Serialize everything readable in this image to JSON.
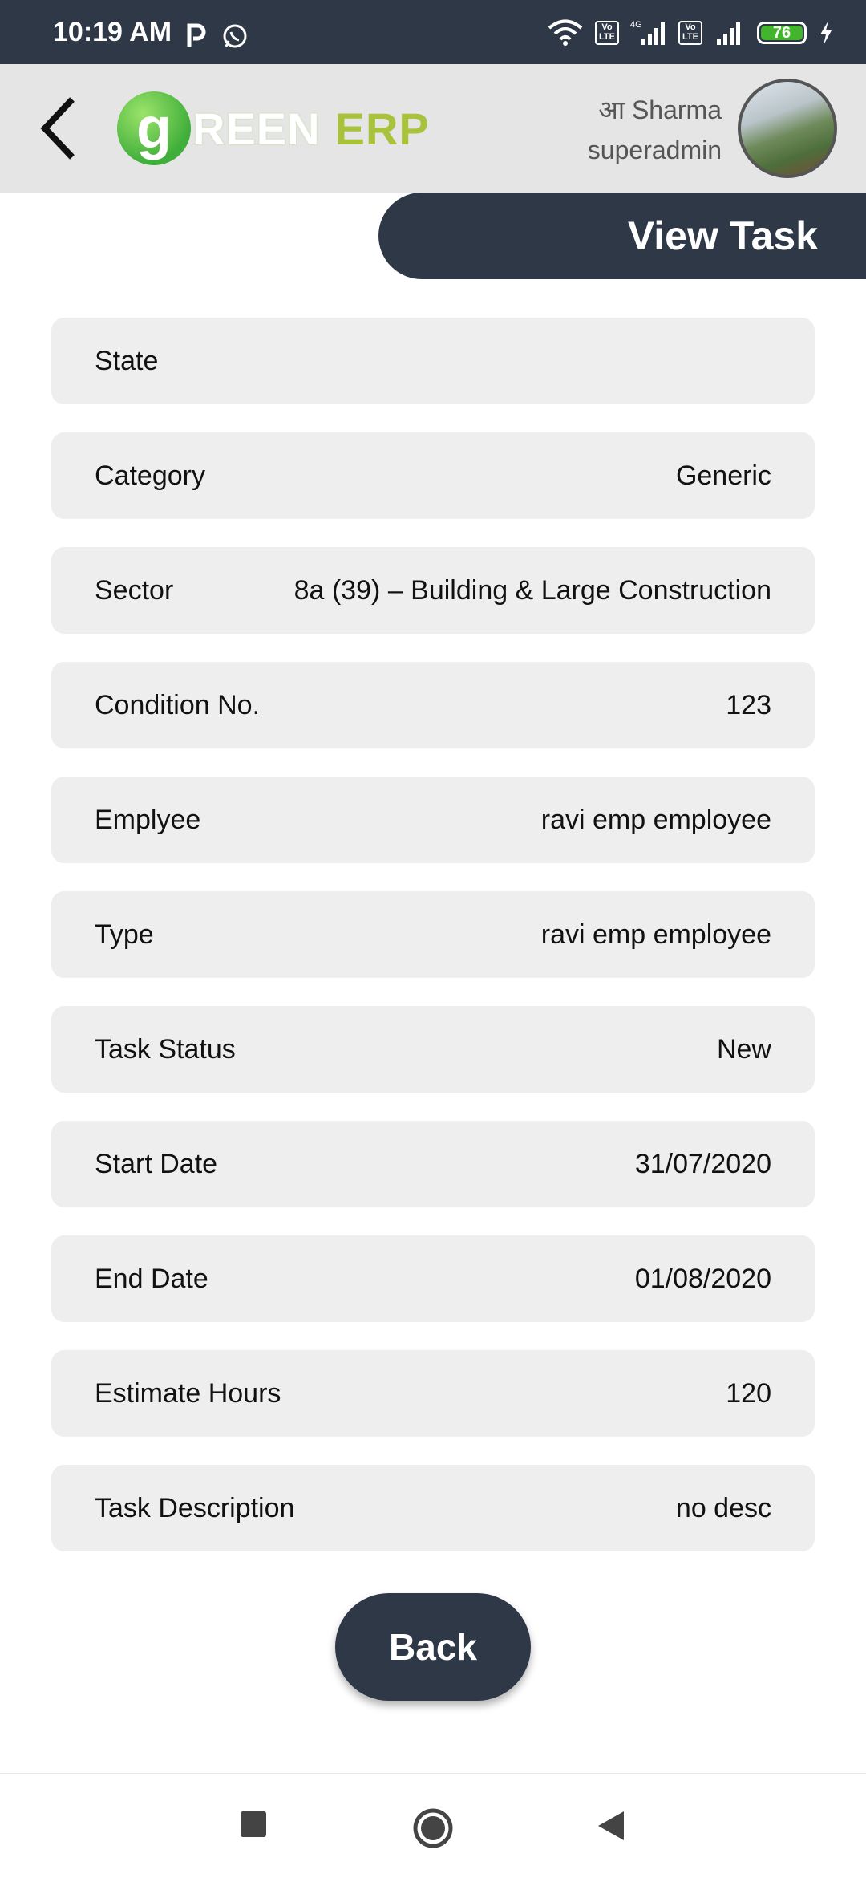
{
  "status_bar": {
    "time": "10:19 AM",
    "battery": "76",
    "lte_label": "Vo LTE",
    "network": "4G",
    "icons": [
      "paytm-icon",
      "whatsapp-icon",
      "wifi-icon",
      "volte-icon",
      "signal-icon",
      "battery-icon",
      "charging-icon"
    ]
  },
  "header": {
    "logo_g": "g",
    "logo_reen": "REEN",
    "logo_erp": "ERP",
    "user_name": "आ Sharma",
    "user_role": "superadmin"
  },
  "page": {
    "title": "View Task"
  },
  "fields": [
    {
      "label": "State",
      "value": ""
    },
    {
      "label": "Category",
      "value": "Generic"
    },
    {
      "label": "Sector",
      "value": "8a (39) – Building & Large Construction"
    },
    {
      "label": "Condition No.",
      "value": "123"
    },
    {
      "label": "Emplyee",
      "value": "ravi emp employee"
    },
    {
      "label": "Type",
      "value": "ravi emp employee"
    },
    {
      "label": "Task Status",
      "value": "New"
    },
    {
      "label": "Start Date",
      "value": "31/07/2020"
    },
    {
      "label": "End Date",
      "value": "01/08/2020"
    },
    {
      "label": "Estimate Hours",
      "value": "120"
    },
    {
      "label": "Task Description",
      "value": "no desc"
    }
  ],
  "actions": {
    "back_label": "Back"
  },
  "colors": {
    "primary_dark": "#2e3847",
    "field_bg": "#eeeeee",
    "header_bg": "#e5e5e5",
    "logo_green": "#3fae3a",
    "logo_erp": "#a8c23c"
  }
}
